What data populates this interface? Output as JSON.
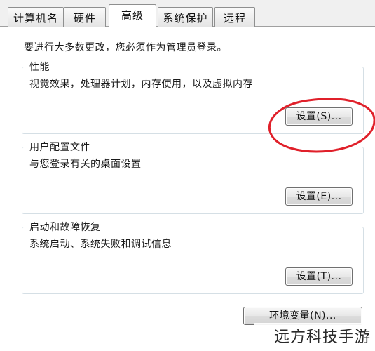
{
  "tabs": [
    {
      "label": "计算机名",
      "active": false
    },
    {
      "label": "硬件",
      "active": false
    },
    {
      "label": "高级",
      "active": true
    },
    {
      "label": "系统保护",
      "active": false
    },
    {
      "label": "远程",
      "active": false
    }
  ],
  "intro": "要进行大多数更改，您必须作为管理员登录。",
  "groups": {
    "performance": {
      "title": "性能",
      "description": "视觉效果，处理器计划，内存使用，以及虚拟内存",
      "button": "设置(S)..."
    },
    "user_profiles": {
      "title": "用户配置文件",
      "description": "与您登录有关的桌面设置",
      "button": "设置(E)..."
    },
    "startup_recovery": {
      "title": "启动和故障恢复",
      "description": "系统启动、系统失败和调试信息",
      "button": "设置(T)..."
    }
  },
  "env_button": "环境变量(N)...",
  "watermark": "远方科技手游",
  "colors": {
    "highlight_circle": "#e0202a",
    "group_border": "#d5dfe5",
    "tab_border": "#8e8f8f"
  }
}
